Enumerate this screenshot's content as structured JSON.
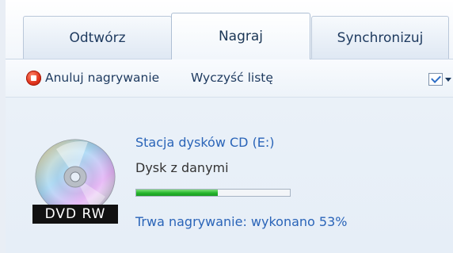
{
  "tabs": [
    {
      "label": "Odtwórz"
    },
    {
      "label": "Nagraj",
      "selected": true
    },
    {
      "label": "Synchronizuj"
    }
  ],
  "toolbar": {
    "cancel_label": "Anuluj nagrywanie",
    "cancel_icon": "stop-icon",
    "clear_label": "Wyczyść listę",
    "options_icon": "list-options-icon"
  },
  "burn": {
    "drive_name": "Stacja dysków CD (E:)",
    "disc_type": "Dysk z danymi",
    "disc_label": "DVD RW",
    "progress_percent": 53,
    "status": "Trwa nagrywanie: wykonano 53%"
  },
  "colors": {
    "accent_text": "#2a64b8",
    "progress_green": "#25b52c",
    "stop_red": "#e0331c"
  }
}
